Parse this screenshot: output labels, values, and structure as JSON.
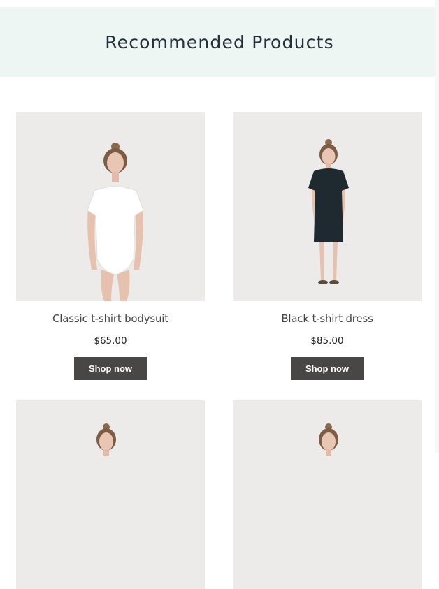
{
  "section": {
    "title": "Recommended Products"
  },
  "products": [
    {
      "name": "Classic t-shirt bodysuit",
      "price": "$65.00",
      "button_label": "Shop now",
      "garment_color": "#ffffff"
    },
    {
      "name": "Black t-shirt dress",
      "price": "$85.00",
      "button_label": "Shop now",
      "garment_color": "#1f2a30"
    },
    {
      "name": "",
      "price": "",
      "button_label": "",
      "garment_color": "#ffffff"
    },
    {
      "name": "",
      "price": "",
      "button_label": "",
      "garment_color": "#ffffff"
    }
  ],
  "colors": {
    "header_bg": "#edf6f3",
    "image_bg": "#ecebea",
    "button_bg": "#494646",
    "button_text": "#ffffff"
  }
}
